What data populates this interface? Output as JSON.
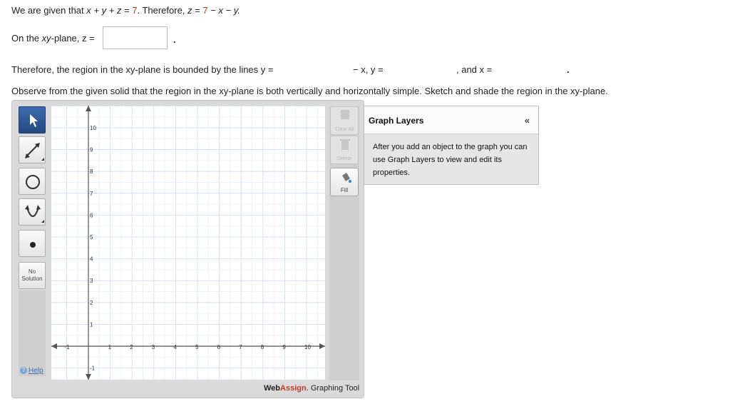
{
  "problem": {
    "line1": {
      "prefix": "We are given that ",
      "equation": "x + y + z = ",
      "value": "7",
      "middle": ". Therefore, ",
      "z": "z",
      "eq": " = ",
      "value2": "7",
      "rest": " − x − y."
    },
    "line2": {
      "prefix": "On the ",
      "xy": "xy",
      "suffix": "-plane, z =",
      "answer": "",
      "period": "."
    },
    "line3": {
      "text": "Therefore, the region in the xy-plane is bounded by the lines y =",
      "answer1": "",
      "mid": "− x, y =",
      "answer2": "",
      "end": ", and x =",
      "answer3": "",
      "period": "."
    },
    "line4": "Observe from the given solid that the region in the xy-plane is both vertically and horizontally simple. Sketch and shade the region in the xy-plane."
  },
  "graph_tool": {
    "tools": [
      {
        "name": "select-tool",
        "icon": "arrow-pointer-icon",
        "active": true
      },
      {
        "name": "line-tool",
        "icon": "line-segment-icon",
        "active": false
      },
      {
        "name": "circle-tool",
        "icon": "circle-icon",
        "active": false
      },
      {
        "name": "parabola-tool",
        "icon": "parabola-icon",
        "active": false
      },
      {
        "name": "point-tool",
        "icon": "point-icon",
        "active": false
      }
    ],
    "no_solution": [
      "No",
      "Solution"
    ],
    "help": "Help",
    "clear_all": "Clear All",
    "delete": "Delete",
    "fill": "Fill",
    "brand_web": "Web",
    "brand_assign": "Assign",
    "brand_suffix": ". Graphing Tool",
    "y_ticks": [
      "10",
      "9",
      "8",
      "7",
      "6",
      "5",
      "4",
      "3",
      "2",
      "1",
      "-1"
    ],
    "x_ticks": [
      "-1",
      "1",
      "2",
      "3",
      "4",
      "5",
      "6",
      "7",
      "8",
      "9",
      "10"
    ],
    "accent": "#2f5a96"
  },
  "layers": {
    "title": "Graph Layers",
    "collapse": "«",
    "body": "After you add an object to the graph you can use Graph Layers to view and edit its properties."
  }
}
